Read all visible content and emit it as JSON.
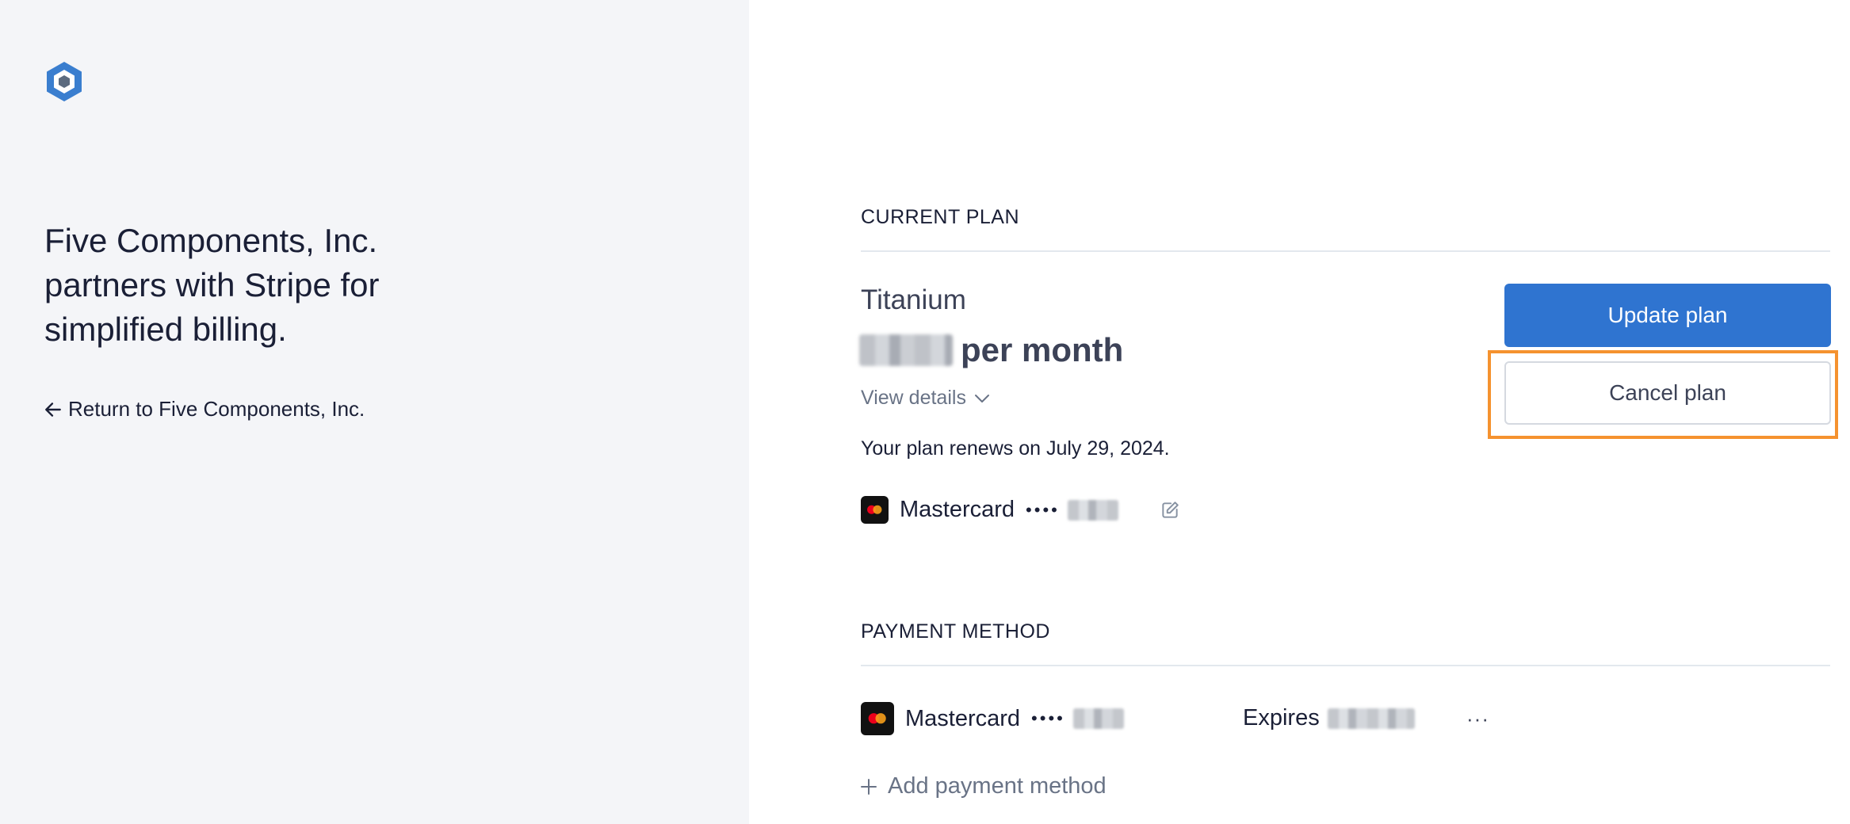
{
  "brand": {
    "logo_icon": "hexagon-logo-icon",
    "accent_color": "#2f74d0",
    "highlight_color": "#f5922f"
  },
  "left": {
    "tagline_lines": [
      "Five Components, Inc.",
      "partners with Stripe for",
      "simplified billing."
    ],
    "return_link": "Return to Five Components, Inc.",
    "return_icon": "arrow-left-icon"
  },
  "current_plan": {
    "heading": "CURRENT PLAN",
    "plan_name": "Titanium",
    "price_suffix": "per month",
    "view_details": "View details",
    "view_details_icon": "chevron-down-icon",
    "renews_text": "Your plan renews on July 29, 2024.",
    "card_brand": "Mastercard",
    "card_dots": "••••",
    "edit_icon": "edit-icon",
    "update_button": "Update plan",
    "cancel_button": "Cancel plan"
  },
  "payment_method": {
    "heading": "PAYMENT METHOD",
    "card_brand": "Mastercard",
    "card_dots": "••••",
    "expires_label": "Expires",
    "more_label": "···",
    "add_label": "Add payment method",
    "add_icon": "plus-icon"
  }
}
